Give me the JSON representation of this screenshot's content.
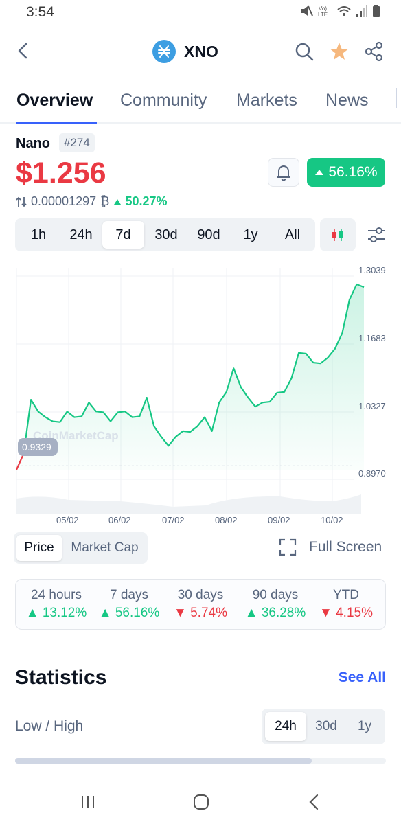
{
  "status_bar": {
    "time": "3:54"
  },
  "header": {
    "symbol": "XNO"
  },
  "tabs": [
    {
      "label": "Overview"
    },
    {
      "label": "Community"
    },
    {
      "label": "Markets"
    },
    {
      "label": "News"
    }
  ],
  "coin": {
    "name": "Nano",
    "rank": "#274",
    "price": "$1.256",
    "btc_price": "0.00001297",
    "btc_symbol": "₿",
    "btc_change": "50.27%",
    "change_7d": "56.16%"
  },
  "time_ranges": [
    "1h",
    "24h",
    "7d",
    "30d",
    "90d",
    "1y",
    "All"
  ],
  "selected_range": "7d",
  "chart_modes": [
    "Price",
    "Market Cap"
  ],
  "selected_chart_mode": "Price",
  "full_screen_label": "Full Screen",
  "chart_data": {
    "type": "area",
    "y_ticks": [
      "1.3039",
      "1.1683",
      "1.0327",
      "0.8970"
    ],
    "x_ticks": [
      "05/02",
      "06/02",
      "07/02",
      "08/02",
      "09/02",
      "10/02"
    ],
    "start_marker": "0.9329",
    "watermark": "CoinMarketCap",
    "ylim": [
      0.897,
      1.3039
    ],
    "grid": true,
    "series": [
      {
        "values": [
          0.897,
          0.93,
          1.04,
          1.02,
          1.0,
          1.0,
          0.99,
          1.02,
          1.0,
          1.01,
          1.03,
          1.02,
          1.01,
          1.0,
          1.01,
          1.02,
          1.0,
          1.01,
          1.04,
          0.99,
          0.96,
          0.95,
          0.96,
          0.98,
          0.97,
          0.99,
          1.0,
          0.98,
          1.03,
          1.06,
          1.1,
          1.07,
          1.04,
          1.03,
          1.03,
          1.04,
          1.05,
          1.06,
          1.08,
          1.14,
          1.13,
          1.12,
          1.11,
          1.13,
          1.14,
          1.18,
          1.24,
          1.28,
          1.27
        ]
      }
    ],
    "colors": {
      "line": "#16c784",
      "down": "#ea3943"
    }
  },
  "performance": [
    {
      "label": "24 hours",
      "value": "13.12%",
      "dir": "up"
    },
    {
      "label": "7 days",
      "value": "56.16%",
      "dir": "up"
    },
    {
      "label": "30 days",
      "value": "5.74%",
      "dir": "down"
    },
    {
      "label": "90 days",
      "value": "36.28%",
      "dir": "up"
    },
    {
      "label": "YTD",
      "value": "4.15%",
      "dir": "down"
    }
  ],
  "statistics": {
    "title": "Statistics",
    "see_all": "See All",
    "low_high_label": "Low / High",
    "periods": [
      "24h",
      "30d",
      "1y"
    ],
    "selected_period": "24h",
    "low_high_position": 0.8
  },
  "colors": {
    "accent": "#3861fb",
    "up": "#16c784",
    "down": "#ea3943"
  }
}
